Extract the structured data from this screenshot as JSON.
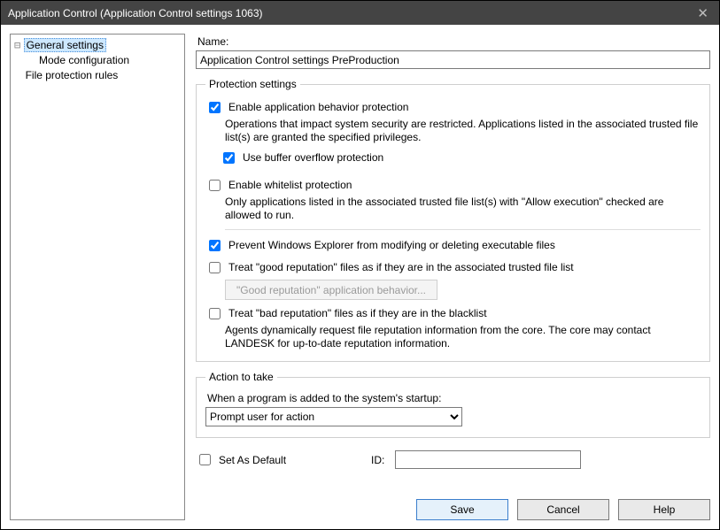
{
  "window": {
    "title": "Application Control (Application Control settings 1063)"
  },
  "tree": {
    "items": [
      {
        "label": "General settings",
        "indent": 0,
        "expander": "⊟",
        "selected": true
      },
      {
        "label": "Mode configuration",
        "indent": 1,
        "expander": "",
        "selected": false
      },
      {
        "label": "File protection rules",
        "indent": 0,
        "expander": "",
        "selected": false
      }
    ]
  },
  "form": {
    "name_label": "Name:",
    "name_value": "Application Control settings PreProduction"
  },
  "protection": {
    "legend": "Protection settings",
    "enable_behavior": {
      "label": "Enable application behavior protection",
      "checked": true,
      "desc": "Operations that impact system security are restricted.  Applications listed in the associated trusted file list(s) are granted the specified privileges."
    },
    "buffer_overflow": {
      "label": "Use buffer overflow protection",
      "checked": true
    },
    "whitelist": {
      "label": "Enable whitelist protection",
      "checked": false,
      "desc": "Only applications listed in the associated trusted file list(s) with \"Allow execution\" checked are allowed to run."
    },
    "prevent_explorer": {
      "label": "Prevent Windows Explorer from modifying or deleting executable files",
      "checked": true
    },
    "good_rep": {
      "label": "Treat \"good reputation\" files as if they are in the associated trusted file list",
      "checked": false,
      "button": "\"Good reputation\" application behavior..."
    },
    "bad_rep": {
      "label": "Treat \"bad reputation\" files as if they are in the blacklist",
      "checked": false,
      "desc": "Agents dynamically request file reputation information from the core.  The core may contact LANDESK for up-to-date reputation information."
    }
  },
  "action": {
    "legend": "Action to take",
    "prompt_label": "When a program is added to the system's startup:",
    "selected": "Prompt user for action"
  },
  "footer": {
    "set_default": {
      "label": "Set As Default",
      "checked": false
    },
    "id_label": "ID:",
    "id_value": ""
  },
  "buttons": {
    "save": "Save",
    "cancel": "Cancel",
    "help": "Help"
  }
}
